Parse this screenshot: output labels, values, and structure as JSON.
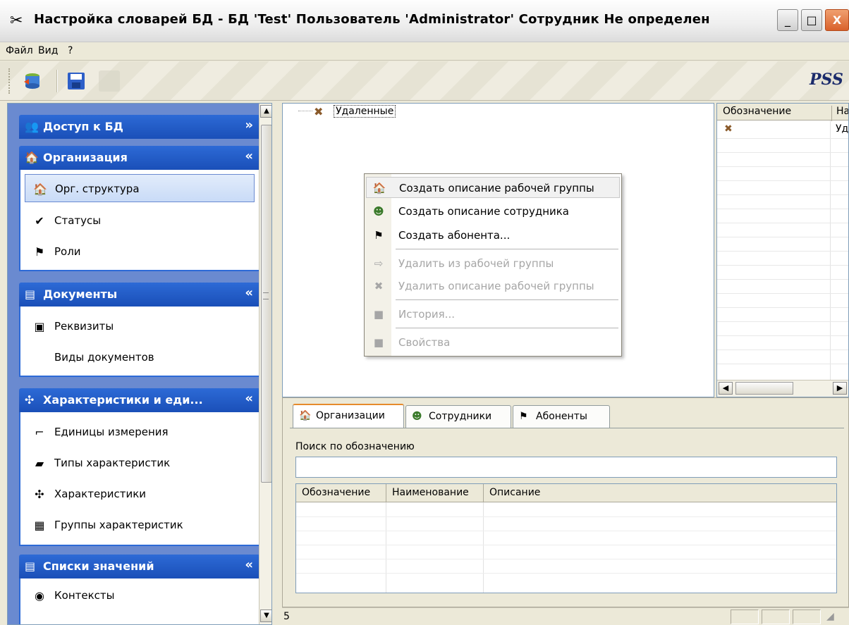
{
  "window": {
    "title": "Настройка словарей БД - БД 'Test' Пользователь 'Administrator' Сотрудник Не определен",
    "buttons": {
      "minimize": "_",
      "maximize": "□",
      "close": "X"
    }
  },
  "menu": [
    "Файл",
    "Вид",
    "?"
  ],
  "toolbar": {
    "brand": "PSS"
  },
  "nav": {
    "groups": [
      {
        "title": "Доступ к БД",
        "icon": "users-icon",
        "expanded": false,
        "items": []
      },
      {
        "title": "Организация",
        "icon": "house-icon",
        "expanded": true,
        "items": [
          {
            "label": "Орг. структура",
            "icon": "house-icon",
            "selected": true
          },
          {
            "label": "Статусы",
            "icon": "checkmark-icon"
          },
          {
            "label": "Роли",
            "icon": "flag-icon"
          }
        ]
      },
      {
        "title": "Документы",
        "icon": "documents-icon",
        "expanded": true,
        "items": [
          {
            "label": "Реквизиты",
            "icon": "form-icon"
          },
          {
            "label": "Виды документов",
            "icon": ""
          }
        ]
      },
      {
        "title": "Характеристики и еди...",
        "icon": "characteristics-icon",
        "expanded": true,
        "items": [
          {
            "label": "Единицы измерения",
            "icon": "ruler-icon"
          },
          {
            "label": "Типы характеристик",
            "icon": "type-icon"
          },
          {
            "label": "Характеристики",
            "icon": "characteristics-icon"
          },
          {
            "label": "Группы характеристик",
            "icon": "group-icon"
          }
        ]
      },
      {
        "title": "Списки значений",
        "icon": "documents-icon",
        "expanded": true,
        "items": [
          {
            "label": "Контексты",
            "icon": "context-icon"
          }
        ]
      }
    ]
  },
  "tree": {
    "root_label": "Удаленные"
  },
  "context_menu": {
    "items": [
      {
        "label": "Создать описание рабочей группы",
        "icon": "house-icon",
        "enabled": true
      },
      {
        "label": "Создать описание сотрудника",
        "icon": "person-icon",
        "enabled": true
      },
      {
        "label": "Создать абонента...",
        "icon": "flag-icon",
        "enabled": true
      },
      {
        "label": "Удалить из рабочей группы",
        "icon": "arrow-right-icon",
        "enabled": false
      },
      {
        "label": "Удалить описание рабочей группы",
        "icon": "delete-x-icon",
        "enabled": false
      },
      {
        "label": "История...",
        "icon": "history-icon",
        "enabled": false
      },
      {
        "label": "Свойства",
        "icon": "properties-icon",
        "enabled": false
      }
    ]
  },
  "right_grid": {
    "columns": [
      "Обозначение",
      "На"
    ],
    "rows": [
      {
        "c2": "Уд"
      }
    ]
  },
  "bottom": {
    "tabs": [
      {
        "label": "Организации",
        "icon": "house-icon",
        "active": true
      },
      {
        "label": "Сотрудники",
        "icon": "person-icon",
        "active": false
      },
      {
        "label": "Абоненты",
        "icon": "flag-icon",
        "active": false
      }
    ],
    "search_label": "Поиск по обозначению",
    "search_value": "",
    "grid_columns": [
      "Обозначение",
      "Наименование",
      "Описание"
    ]
  },
  "status": {
    "count": "5"
  },
  "colors": {
    "nav_header": "#1a4fb8",
    "nav_bg": "#6a8ad0",
    "tab_accent": "#e68b2c"
  }
}
